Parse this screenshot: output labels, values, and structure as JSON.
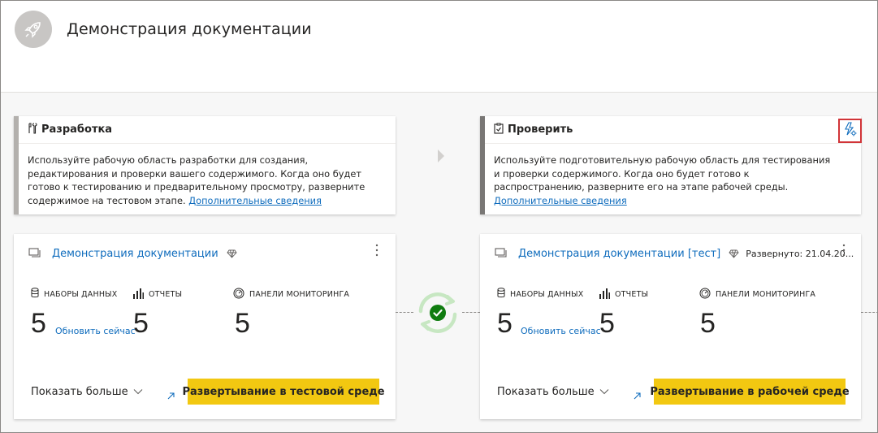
{
  "header": {
    "title": "Демонстрация документации",
    "logo_icon": "rocket-icon"
  },
  "stages": [
    {
      "name": "Разработка",
      "icon": "tools-icon",
      "bar_color": "#b3b0ad",
      "description": "Используйте рабочую область разработки для создания, редактирования и проверки вашего содержимого. Когда оно будет готово к тестированию и предварительному просмотру, разверните содержимое на тестовом этапе.",
      "learn_more": "Дополнительные сведения"
    },
    {
      "name": "Проверить",
      "icon": "clipboard-check-icon",
      "bar_color": "#797775",
      "description": "Используйте подготовительную рабочую область для тестирования и проверки содержимого. Когда оно будет готово к распространению, разверните его на этапе рабочей среды.",
      "learn_more": "Дополнительные сведения",
      "action_icon": "deployment-rules-icon"
    }
  ],
  "workspaces": [
    {
      "title": "Демонстрация документации",
      "premium_icon": "diamond-icon",
      "deployed": "",
      "datasets_label": "НАБОРЫ ДАННЫХ",
      "datasets_value": "5",
      "refresh_label": "Обновить сейчас",
      "reports_label": "ОТЧЕТЫ",
      "reports_value": "5",
      "dashboards_label": "ПАНЕЛИ МОНИТОРИНГА",
      "dashboards_value": "5",
      "show_more": "Показать больше",
      "deploy_button": "Развертывание в тестовой среде"
    },
    {
      "title": "Демонстрация документации [тест]",
      "premium_icon": "diamond-icon",
      "deployed": "Развернуто: 21.04.20...",
      "datasets_label": "НАБОРЫ ДАННЫХ",
      "datasets_value": "5",
      "refresh_label": "Обновить сейчас",
      "reports_label": "ОТЧЕТЫ",
      "reports_value": "5",
      "dashboards_label": "ПАНЕЛИ МОНИТОРИНГА",
      "dashboards_value": "5",
      "show_more": "Показать больше",
      "deploy_button": "Развертывание в рабочей среде"
    }
  ],
  "compare_status": {
    "icon": "sync-check-icon",
    "state": "synced",
    "accent_color": "#107c10"
  }
}
